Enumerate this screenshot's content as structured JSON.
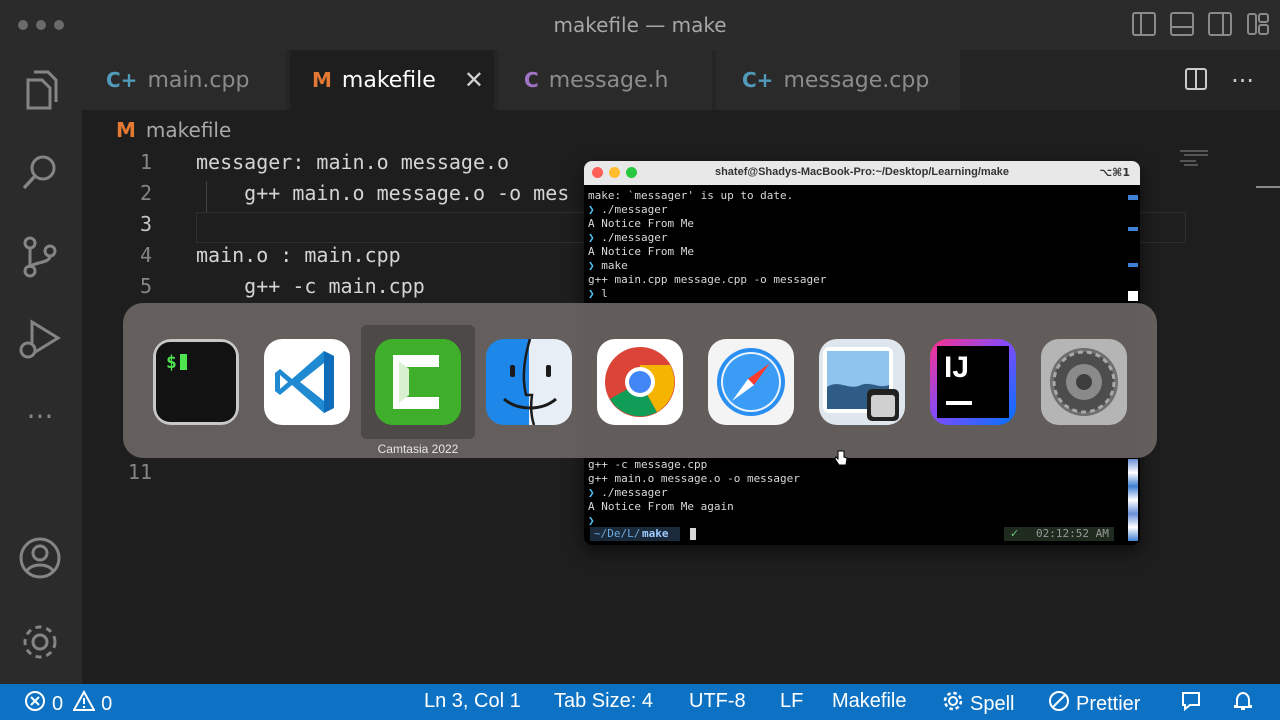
{
  "window": {
    "title": "makefile — make"
  },
  "tabs": [
    {
      "label": "main.cpp",
      "icon": "cpp-icon",
      "icon_glyph": "C+",
      "icon_color": "#519aba",
      "active": false
    },
    {
      "label": "makefile",
      "icon": "makefile-icon",
      "icon_glyph": "M",
      "icon_color": "#e37933",
      "active": true
    },
    {
      "label": "message.h",
      "icon": "c-header-icon",
      "icon_glyph": "C",
      "icon_color": "#a074c4",
      "active": false
    },
    {
      "label": "message.cpp",
      "icon": "cpp-icon",
      "icon_glyph": "C+",
      "icon_color": "#519aba",
      "active": false
    }
  ],
  "breadcrumb": {
    "icon_glyph": "M",
    "file": "makefile"
  },
  "editor": {
    "lines": [
      {
        "number": "1",
        "text": "messager: main.o message.o"
      },
      {
        "number": "2",
        "text": "    g++ main.o message.o -o mes"
      },
      {
        "number": "3",
        "text": ""
      },
      {
        "number": "4",
        "text": "main.o : main.cpp"
      },
      {
        "number": "5",
        "text": "    g++ -c main.cpp"
      },
      {
        "number": "11",
        "text": ""
      }
    ],
    "current_line": "3"
  },
  "terminal": {
    "title": "shatef@Shadys-MacBook-Pro:~/Desktop/Learning/make",
    "shortcut": "⌥⌘1",
    "top_lines": [
      {
        "prompt": "",
        "text": "make: `messager' is up to date."
      },
      {
        "prompt": "❯",
        "text": " ./messager"
      },
      {
        "prompt": "",
        "text": "A Notice From Me"
      },
      {
        "prompt": "❯",
        "text": " ./messager"
      },
      {
        "prompt": "",
        "text": "A Notice From Me"
      },
      {
        "prompt": "❯",
        "text": " make"
      },
      {
        "prompt": "",
        "text": "g++ main.cpp message.cpp -o messager"
      },
      {
        "prompt": "❯",
        "text": " l"
      }
    ],
    "bottom_lines": [
      {
        "prompt": "",
        "text": "g++ -c message.cpp"
      },
      {
        "prompt": "",
        "text": "g++ main.o message.o -o messager"
      },
      {
        "prompt": "❯",
        "text": " ./messager"
      },
      {
        "prompt": "",
        "text": "A Notice From Me again"
      },
      {
        "prompt": "❯",
        "text": ""
      }
    ],
    "status_path_prefix": "~/De/L/",
    "status_path_dir": "make",
    "status_check": "✓",
    "status_time": "02:12:52 AM"
  },
  "app_switcher": {
    "selected_label": "Camtasia 2022",
    "apps": [
      {
        "name": "terminal-app-icon"
      },
      {
        "name": "vscode-app-icon"
      },
      {
        "name": "camtasia-app-icon"
      },
      {
        "name": "finder-app-icon"
      },
      {
        "name": "chrome-app-icon"
      },
      {
        "name": "safari-app-icon"
      },
      {
        "name": "preview-app-icon"
      },
      {
        "name": "intellij-app-icon",
        "text": "IJ"
      },
      {
        "name": "system-preferences-app-icon"
      }
    ]
  },
  "statusbar": {
    "errors": "0",
    "warnings": "0",
    "position": "Ln 3, Col 1",
    "tab_size": "Tab Size: 4",
    "encoding": "UTF-8",
    "eol": "LF",
    "language": "Makefile",
    "spell": "Spell",
    "prettier": "Prettier",
    "color": "#0e72c4"
  }
}
